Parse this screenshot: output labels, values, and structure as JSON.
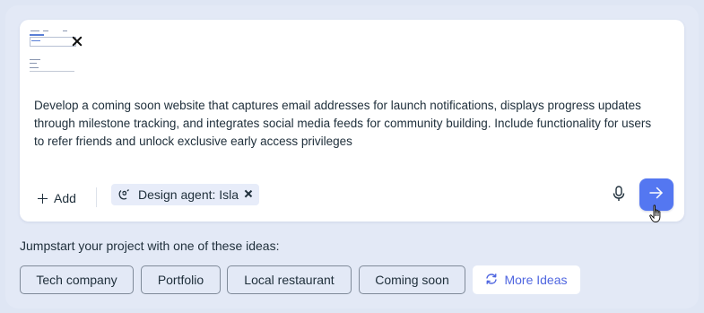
{
  "prompt": {
    "text": "Develop a coming soon website that captures email addresses for launch notifications, displays progress updates through milestone tracking, and integrates social media feeds for community building. Include functionality for users to refer friends and unlock exclusive early access privileges"
  },
  "toolbar": {
    "add_label": "Add",
    "agent_chip_label": "Design agent: Isla"
  },
  "ideas": {
    "heading": "Jumpstart your project with one of these ideas:",
    "chips": [
      "Tech company",
      "Portfolio",
      "Local restaurant",
      "Coming soon"
    ],
    "more_label": "More Ideas"
  },
  "colors": {
    "accent": "#5477f1",
    "more_ideas_text": "#4f66e0",
    "background": "#dfe6f4"
  },
  "icons": {
    "attachment_close": "close-icon",
    "add": "plus-icon",
    "agent": "agent-icon",
    "chip_close": "close-icon",
    "mic": "microphone-icon",
    "send": "arrow-right-icon",
    "more_ideas": "refresh-icon",
    "cursor": "hand-pointer-icon"
  }
}
